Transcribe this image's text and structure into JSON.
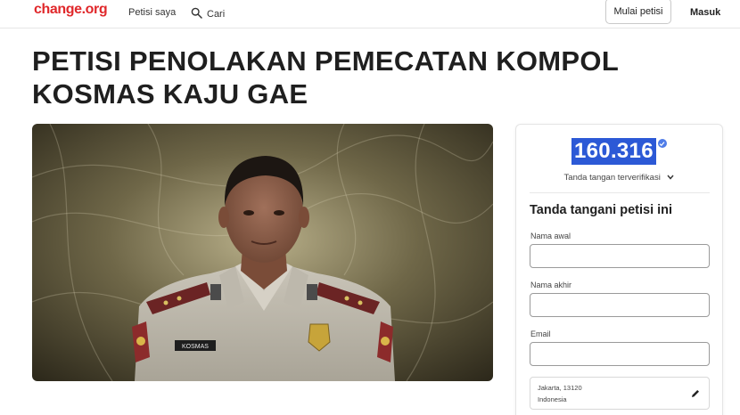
{
  "header": {
    "logo": "change.org",
    "nav_my_petitions": "Petisi saya",
    "nav_search": "Cari",
    "start_petition": "Mulai petisi",
    "login": "Masuk"
  },
  "petition": {
    "title": "PETISI PENOLAKAN PEMECATAN KOMPOL KOSMAS KAJU GAE",
    "photo_name_tag": "KOSMAS"
  },
  "sign_card": {
    "count": "160.316",
    "verified_label": "Tanda tangan terverifikasi",
    "heading": "Tanda tangani petisi ini",
    "first_name_label": "Nama awal",
    "last_name_label": "Nama akhir",
    "email_label": "Email",
    "location_line1": "Jakarta, 13120",
    "location_line2": "Indonesia"
  },
  "colors": {
    "brand_red": "#e0282b",
    "highlight_blue": "#2c59d6",
    "verified_blue": "#4f7ce8"
  },
  "icons": {
    "search": "search-icon",
    "chevron": "chevron-down-icon",
    "verified": "verified-check-icon",
    "edit": "pencil-icon"
  }
}
